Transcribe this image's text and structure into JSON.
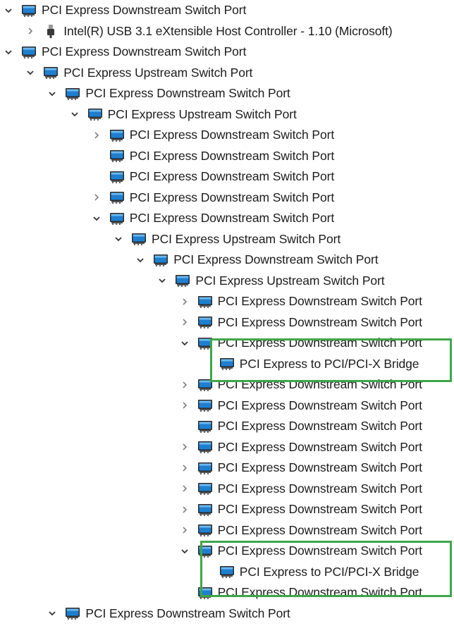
{
  "tree": {
    "rows": [
      {
        "depth": 0,
        "chevron": "expanded",
        "icon": "pci-port-icon",
        "label": "PCI Express Downstream Switch Port"
      },
      {
        "depth": 1,
        "chevron": "collapsed",
        "icon": "usb-plug-icon",
        "label": "Intel(R) USB 3.1 eXtensible Host Controller - 1.10 (Microsoft)"
      },
      {
        "depth": 0,
        "chevron": "expanded",
        "icon": "pci-port-icon",
        "label": "PCI Express Downstream Switch Port"
      },
      {
        "depth": 1,
        "chevron": "expanded",
        "icon": "pci-port-icon",
        "label": "PCI Express Upstream Switch Port"
      },
      {
        "depth": 2,
        "chevron": "expanded",
        "icon": "pci-port-icon",
        "label": "PCI Express Downstream Switch Port"
      },
      {
        "depth": 3,
        "chevron": "expanded",
        "icon": "pci-port-icon",
        "label": "PCI Express Upstream Switch Port"
      },
      {
        "depth": 4,
        "chevron": "collapsed",
        "icon": "pci-port-icon",
        "label": "PCI Express Downstream Switch Port"
      },
      {
        "depth": 4,
        "chevron": "none",
        "icon": "pci-port-icon",
        "label": "PCI Express Downstream Switch Port"
      },
      {
        "depth": 4,
        "chevron": "none",
        "icon": "pci-port-icon",
        "label": "PCI Express Downstream Switch Port"
      },
      {
        "depth": 4,
        "chevron": "collapsed",
        "icon": "pci-port-icon",
        "label": "PCI Express Downstream Switch Port"
      },
      {
        "depth": 4,
        "chevron": "expanded",
        "icon": "pci-port-icon",
        "label": "PCI Express Downstream Switch Port"
      },
      {
        "depth": 5,
        "chevron": "expanded",
        "icon": "pci-port-icon",
        "label": "PCI Express Upstream Switch Port"
      },
      {
        "depth": 6,
        "chevron": "expanded",
        "icon": "pci-port-icon",
        "label": "PCI Express Downstream Switch Port"
      },
      {
        "depth": 7,
        "chevron": "expanded",
        "icon": "pci-port-icon",
        "label": "PCI Express Upstream Switch Port"
      },
      {
        "depth": 8,
        "chevron": "collapsed",
        "icon": "pci-port-icon",
        "label": "PCI Express Downstream Switch Port"
      },
      {
        "depth": 8,
        "chevron": "collapsed",
        "icon": "pci-port-icon",
        "label": "PCI Express Downstream Switch Port"
      },
      {
        "depth": 8,
        "chevron": "expanded",
        "icon": "pci-port-icon",
        "label": "PCI Express Downstream Switch Port"
      },
      {
        "depth": 9,
        "chevron": "none",
        "icon": "pci-port-icon",
        "label": "PCI Express to PCI/PCI-X Bridge"
      },
      {
        "depth": 8,
        "chevron": "collapsed",
        "icon": "pci-port-icon",
        "label": "PCI Express Downstream Switch Port"
      },
      {
        "depth": 8,
        "chevron": "collapsed",
        "icon": "pci-port-icon",
        "label": "PCI Express Downstream Switch Port"
      },
      {
        "depth": 8,
        "chevron": "none",
        "icon": "pci-port-icon",
        "label": "PCI Express Downstream Switch Port"
      },
      {
        "depth": 8,
        "chevron": "collapsed",
        "icon": "pci-port-icon",
        "label": "PCI Express Downstream Switch Port"
      },
      {
        "depth": 8,
        "chevron": "collapsed",
        "icon": "pci-port-icon",
        "label": "PCI Express Downstream Switch Port"
      },
      {
        "depth": 8,
        "chevron": "collapsed",
        "icon": "pci-port-icon",
        "label": "PCI Express Downstream Switch Port"
      },
      {
        "depth": 8,
        "chevron": "collapsed",
        "icon": "pci-port-icon",
        "label": "PCI Express Downstream Switch Port"
      },
      {
        "depth": 8,
        "chevron": "collapsed",
        "icon": "pci-port-icon",
        "label": "PCI Express Downstream Switch Port"
      },
      {
        "depth": 8,
        "chevron": "expanded",
        "icon": "pci-port-icon",
        "label": "PCI Express Downstream Switch Port"
      },
      {
        "depth": 9,
        "chevron": "none",
        "icon": "pci-port-icon",
        "label": "PCI Express to PCI/PCI-X Bridge"
      },
      {
        "depth": 8,
        "chevron": "none",
        "icon": "pci-port-icon",
        "label": "PCI Express Downstream Switch Port"
      },
      {
        "depth": 2,
        "chevron": "expanded",
        "icon": "pci-port-icon",
        "label": "PCI Express Downstream Switch Port"
      }
    ]
  },
  "colors": {
    "highlight": "#3fa64a",
    "icon_blue": "#1e7fd0",
    "chevron": "#333333",
    "chevron_collapsed": "#808080"
  }
}
